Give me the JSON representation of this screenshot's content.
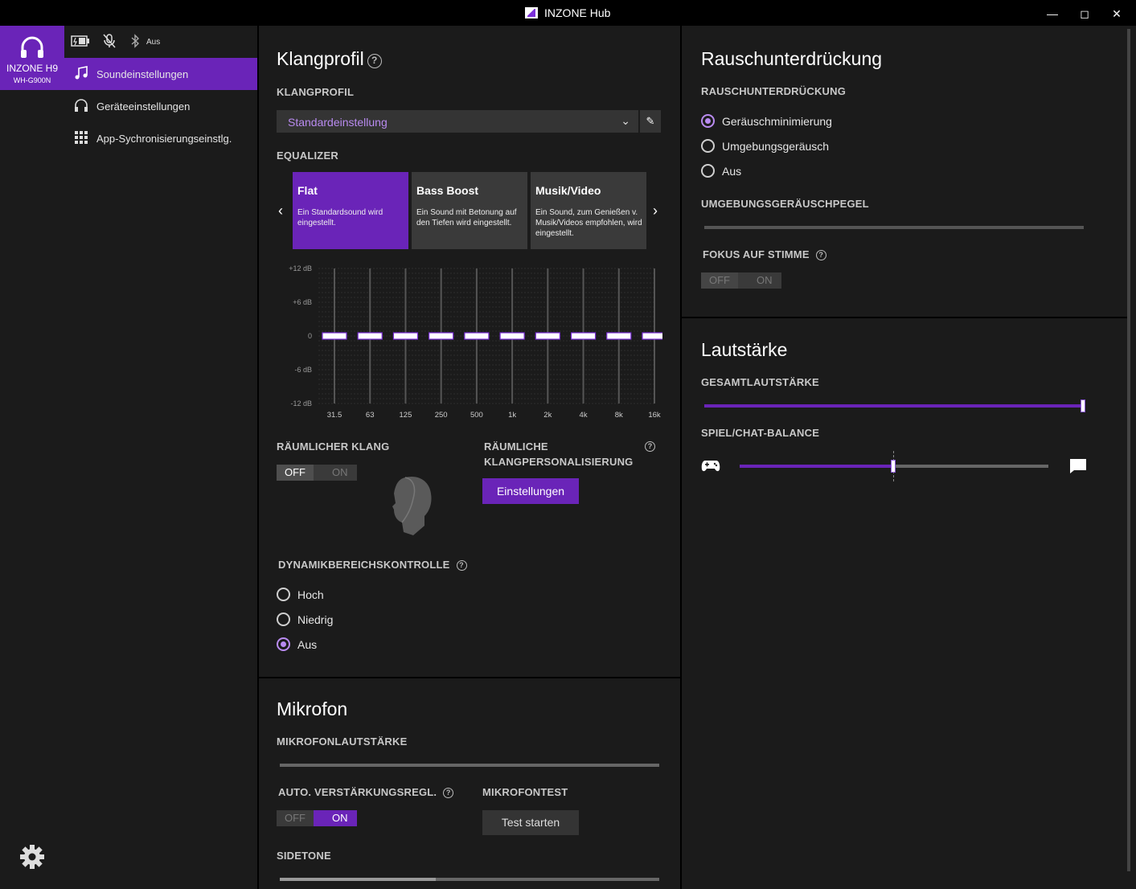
{
  "window": {
    "title": "INZONE Hub"
  },
  "device": {
    "name": "INZONE H9",
    "model": "WH-G900N",
    "bluetooth_status": "Aus"
  },
  "nav": [
    {
      "label": "Soundeinstellungen",
      "icon": "music-note-icon",
      "active": true
    },
    {
      "label": "Geräteeinstellungen",
      "icon": "headphones-icon",
      "active": false
    },
    {
      "label": "App-Sychronisierungseinstlg.",
      "icon": "grid-icon",
      "active": false
    }
  ],
  "sound_profile": {
    "heading": "Klangprofil",
    "profile_label": "KLANGPROFIL",
    "profile_value": "Standardeinstellung",
    "equalizer_label": "EQUALIZER",
    "presets": [
      {
        "title": "Flat",
        "desc": "Ein Standardsound wird eingestellt.",
        "active": true
      },
      {
        "title": "Bass Boost",
        "desc": "Ein Sound mit Betonung auf den Tiefen wird eingestellt.",
        "active": false
      },
      {
        "title": "Musik/Video",
        "desc": "Ein Sound, zum Genießen v. Musik/Videos empfohlen, wird eingestellt.",
        "active": false
      }
    ],
    "eq": {
      "db_labels": [
        "+12 dB",
        "+6 dB",
        "0",
        "-6 dB",
        "-12 dB"
      ],
      "bands": [
        "31.5",
        "63",
        "125",
        "250",
        "500",
        "1k",
        "2k",
        "4k",
        "8k",
        "16k"
      ],
      "values": [
        0,
        0,
        0,
        0,
        0,
        0,
        0,
        0,
        0,
        0
      ],
      "range": [
        -12,
        12
      ]
    },
    "spatial_label": "RÄUMLICHER KLANG",
    "spatial_state": "OFF",
    "personalization_label_1": "RÄUMLICHE",
    "personalization_label_2": "KLANGPERSONALISIERUNG",
    "settings_button": "Einstellungen",
    "drc_label": "DYNAMIKBEREICHSKONTROLLE",
    "drc_options": [
      "Hoch",
      "Niedrig",
      "Aus"
    ],
    "drc_selected": "Aus"
  },
  "toggle": {
    "off": "OFF",
    "on": "ON"
  },
  "microphone": {
    "heading": "Mikrofon",
    "volume_label": "MIKROFONLAUTSTÄRKE",
    "volume_value": 1.0,
    "agc_label": "AUTO. VERSTÄRKUNGSREGL.",
    "agc_state": "ON",
    "test_label": "MIKROFONTEST",
    "test_button": "Test starten",
    "sidetone_label": "SIDETONE",
    "sidetone_value": 0.41
  },
  "noise": {
    "heading": "Rauschunterdrückung",
    "label": "RAUSCHUNTERDRÜCKUNG",
    "options": [
      "Geräuschminimierung",
      "Umgebungsgeräusch",
      "Aus"
    ],
    "selected": "Geräuschminimierung",
    "ambient_label": "UMGEBUNGSGERÄUSCHPEGEL",
    "voice_focus_label": "FOKUS AUF STIMME",
    "voice_focus_state": "OFF"
  },
  "volume": {
    "heading": "Lautstärke",
    "master_label": "GESAMTLAUTSTÄRKE",
    "master_value": 1.0,
    "balance_label": "SPIEL/CHAT-BALANCE",
    "balance_value": 0.5
  },
  "colors": {
    "accent": "#6a24b8",
    "accent_light": "#b98bf0",
    "bg": "#1b1b1b"
  }
}
